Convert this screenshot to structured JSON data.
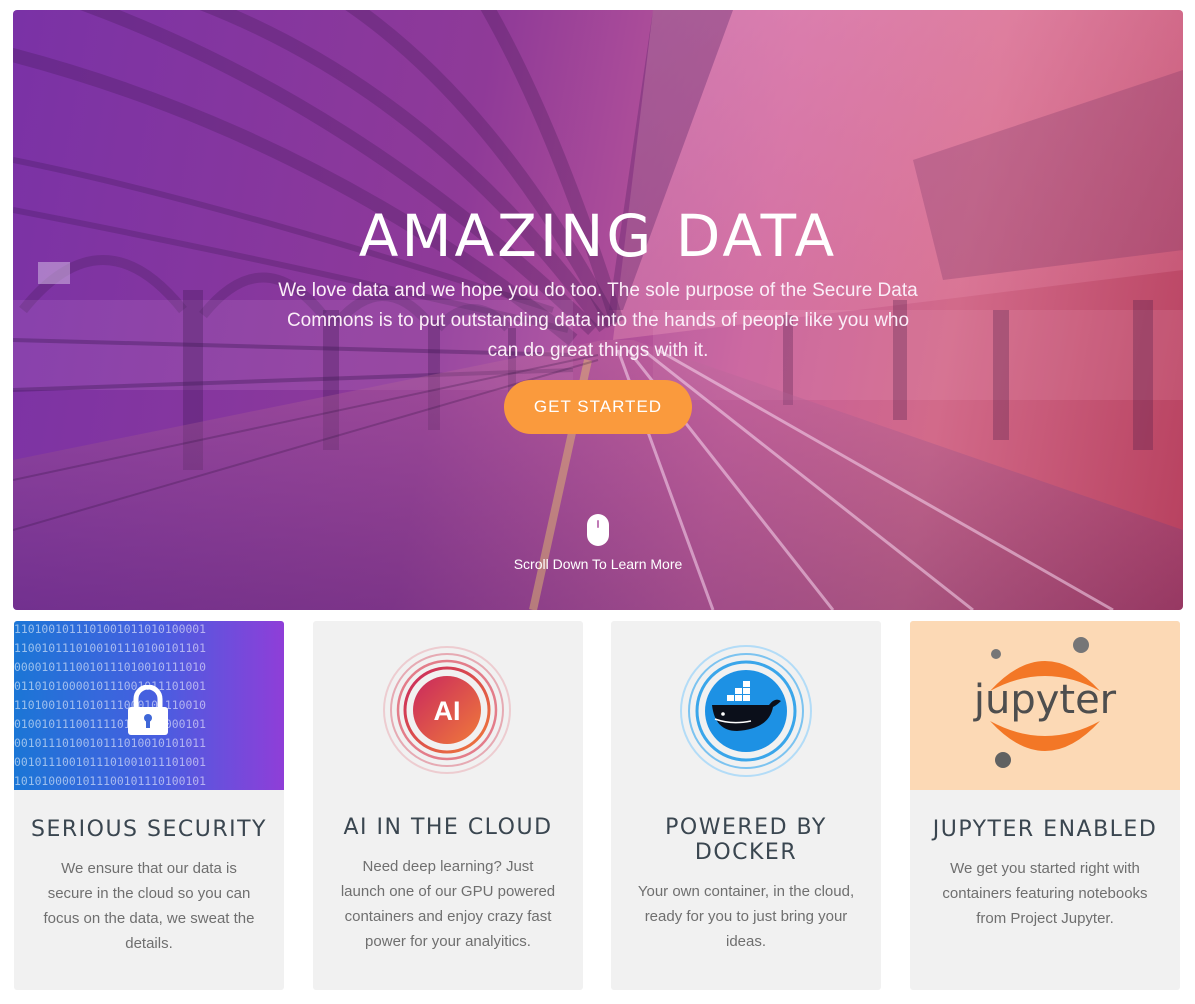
{
  "hero": {
    "title": "AMAZING DATA",
    "lead": "We love data and we hope you do too. The sole purpose of the Secure Data Commons is to put outstanding data into the hands of people like you who can do great things with it.",
    "cta_label": "GET STARTED",
    "scroll_text": "Scroll Down To Learn More",
    "scroll_icon": "mouse-icon"
  },
  "cards": [
    {
      "title": "SERIOUS SECURITY",
      "text": "We ensure that our data is secure in the cloud so you can focus on the data, we sweat the details.",
      "icon": "padlock-icon",
      "binary_rows": [
        "1101001011101001011010100001",
        "1100101110100101110100101101",
        "0000101110010111010010111010",
        "0110101000010111001011101001",
        "1101001011010111000101110010",
        "0100101110011110101010000101",
        "0010111010010111010010101011",
        "0010111001011101001011101001",
        "1010100001011100101110100101"
      ]
    },
    {
      "title": "AI IN THE CLOUD",
      "text": "Need deep learning? Just launch one of our GPU powered containers and enjoy crazy fast power for your analyitics.",
      "icon": "ai-icon",
      "badge": "AI"
    },
    {
      "title": "POWERED BY DOCKER",
      "text": "Your own container, in the cloud, ready for you to just bring your ideas.",
      "icon": "docker-whale-icon"
    },
    {
      "title": "JUPYTER ENABLED",
      "text": "We get you started right with containers featuring notebooks from Project Jupyter.",
      "icon": "jupyter-logo-icon",
      "logo_text": "jupyter"
    }
  ],
  "colors": {
    "hero_gradient_start": "#7a32a6",
    "hero_gradient_end": "#b7405e",
    "cta": "#fa9a3d",
    "card_bg": "#f1f1f1",
    "title": "#3a4650",
    "jupyter_orange": "#f37726"
  }
}
